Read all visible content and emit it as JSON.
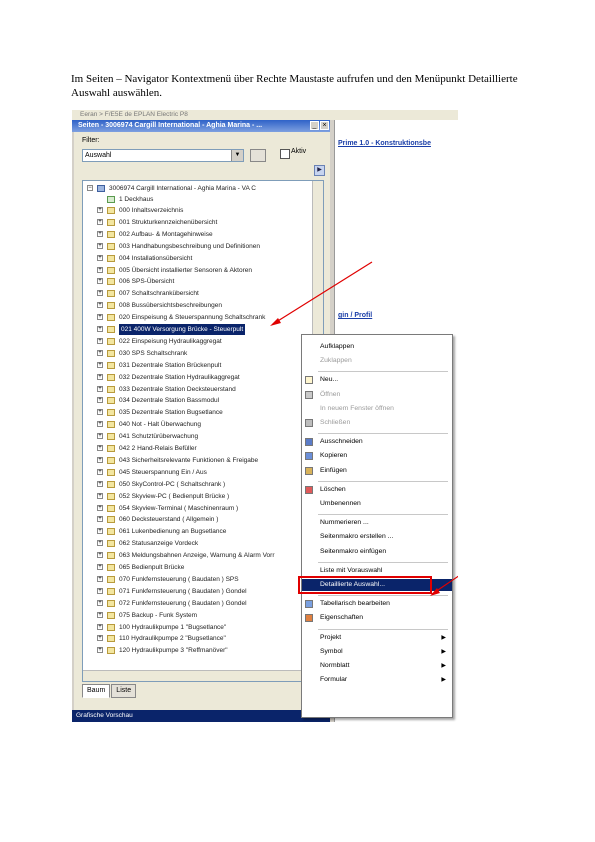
{
  "instruction": "Im Seiten – Navigator Kontextmenü über Rechte Maustaste aufrufen und den Menüpunkt Detaillierte Auswahl auswählen.",
  "background_strip": "Eeran > F/E5E de EPLAN Electric P8",
  "window": {
    "title": "Seiten - 3006974 Cargill International - Aghia Marina - ...",
    "filter_label": "Filter:",
    "filter_value": "Auswahl",
    "active_label": "Aktiv"
  },
  "tree": {
    "root": "3006974 Cargill International - Aghia Marina - VA C",
    "child": "1 Deckhaus",
    "pages": [
      "000 Inhaltsverzeichnis",
      "001 Strukturkennzeichenübersicht",
      "002 Aufbau- & Montagehinweise",
      "003 Handhabungsbeschreibung und Definitionen",
      "004 Installationsübersicht",
      "005 Übersicht installierter Sensoren & Aktoren",
      "006 SPS-Übersicht",
      "007 Schaltschrankübersicht",
      "008 Bussübersichtsbeschreibungen",
      "020 Einspeisung & Steuerspannung Schaltschrank",
      "021 400W Versorgung Brücke - Steuerpult",
      "022 Einspeisung Hydraulikaggregat",
      "030 SPS Schaltschrank",
      "031 Dezentrale Station Brückenpult",
      "032 Dezentrale Station Hydraulikaggregat",
      "033 Dezentrale Station Decksteuerstand",
      "034 Dezentrale Station Bassmodul",
      "035 Dezentrale Station Bugsetlance",
      "040 Not - Halt Überwachung",
      "041 Schutztürüberwachung",
      "042 2 Hand-Relais Befüller",
      "043 Sicherheitsrelevante Funktionen & Freigabe",
      "045 Steuerspannung Ein / Aus",
      "050 SkyControl-PC ( Schaltschrank )",
      "052 Skyview-PC ( Bedienpult Brücke )",
      "054 Skyview-Terminal ( Maschinenraum )",
      "060 Decksteuerstand ( Allgemein )",
      "061 Lukenbedienung an Bugsetlance",
      "062 Statusanzeige Vordeck",
      "063 Meldungsbahnen Anzeige, Warnung & Alarm Vorr",
      "065 Bedienpult Brücke",
      "070 Funkfernsteuerung ( Baudaten ) SPS",
      "071 Funkfernsteuerung ( Baudaten ) Gondel",
      "072 Funkfernsteuerung ( Baudaten ) Gondel",
      "075 Backup - Funk System",
      "100 Hydraulikpumpe 1 \"Bugsetlance\"",
      "110 Hydraulikpumpe 2 \"Bugsetlance\"",
      "120 Hydraulikpumpe 3 \"Reffmanöver\""
    ],
    "selected_index": 10
  },
  "tabs": [
    "Baum",
    "Liste"
  ],
  "status_left": "Grafische Vorschau",
  "right_panel": {
    "link1": "Prime 1.0 - Konstruktionsbe",
    "link2": "gin / Profil"
  },
  "context_menu": {
    "items": [
      {
        "label": "Aufklappen",
        "enabled": true
      },
      {
        "label": "Zuklappen",
        "enabled": false
      },
      {
        "sep": true
      },
      {
        "label": "Neu...",
        "enabled": true,
        "icon": "new-page-icon"
      },
      {
        "label": "Öffnen",
        "enabled": false,
        "icon": "open-icon"
      },
      {
        "label": "In neuem Fenster öffnen",
        "enabled": false
      },
      {
        "label": "Schließen",
        "enabled": false,
        "icon": "close-page-icon"
      },
      {
        "sep": true
      },
      {
        "label": "Ausschneiden",
        "enabled": true,
        "icon": "cut-icon"
      },
      {
        "label": "Kopieren",
        "enabled": true,
        "icon": "copy-icon"
      },
      {
        "label": "Einfügen",
        "enabled": true,
        "icon": "paste-icon"
      },
      {
        "sep": true
      },
      {
        "label": "Löschen",
        "enabled": true,
        "icon": "delete-icon"
      },
      {
        "label": "Umbenennen",
        "enabled": true
      },
      {
        "sep": true
      },
      {
        "label": "Nummerieren ...",
        "enabled": true
      },
      {
        "label": "Seitenmakro erstellen ...",
        "enabled": true
      },
      {
        "label": "Seitenmakro einfügen",
        "enabled": true
      },
      {
        "sep": true
      },
      {
        "label": "Liste mit Vorauswahl",
        "enabled": true
      },
      {
        "label": "Detaillierte Auswahl...",
        "enabled": true,
        "highlight": true
      },
      {
        "sep": true
      },
      {
        "label": "Tabellarisch bearbeiten",
        "enabled": true,
        "icon": "table-edit-icon"
      },
      {
        "label": "Eigenschaften",
        "enabled": true,
        "icon": "properties-icon"
      },
      {
        "sep": true
      },
      {
        "label": "Projekt",
        "enabled": true,
        "submenu": true
      },
      {
        "label": "Symbol",
        "enabled": true,
        "submenu": true
      },
      {
        "label": "Normblatt",
        "enabled": true,
        "submenu": true
      },
      {
        "label": "Formular",
        "enabled": true,
        "submenu": true
      }
    ]
  },
  "colors": {
    "accent_red": "#e00000",
    "selection": "#0a246a",
    "titlebar": "#2f62c8"
  }
}
